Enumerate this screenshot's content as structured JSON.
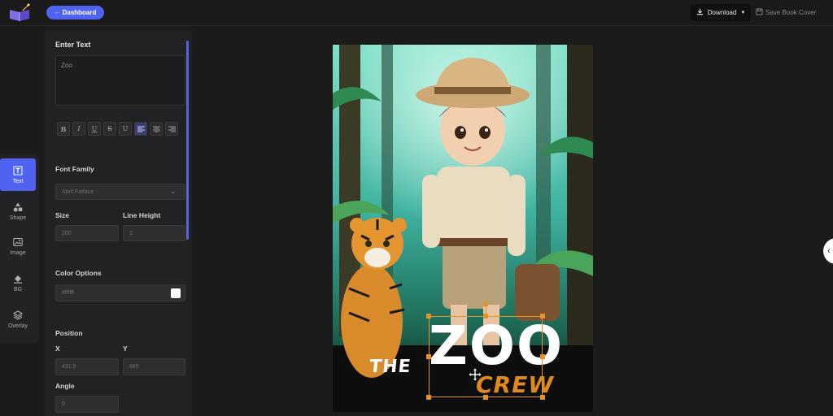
{
  "header": {
    "dashboard_label": "Dashboard",
    "download_label": "Download",
    "save_label": "Save Book Cover"
  },
  "tools": [
    {
      "label": "Text",
      "icon": "text-icon",
      "active": true
    },
    {
      "label": "Shape",
      "icon": "shapes-icon",
      "active": false
    },
    {
      "label": "Image",
      "icon": "image-icon",
      "active": false
    },
    {
      "label": "BG",
      "icon": "paint-bucket-icon",
      "active": false
    },
    {
      "label": "Overlay",
      "icon": "layers-icon",
      "active": false
    }
  ],
  "panel": {
    "enter_text_label": "Enter Text",
    "text_value": "Zoo",
    "format_buttons": [
      "B",
      "I",
      "U",
      "S",
      "U",
      "align-left",
      "align-center",
      "align-right"
    ],
    "font_family_label": "Font Family",
    "font_family_value": "Abril Fatface",
    "size_label": "Size",
    "size_value": "200",
    "line_height_label": "Line Height",
    "line_height_value": "1",
    "color_options_label": "Color Options",
    "color_value": "#ffffff",
    "position_label": "Position",
    "x_label": "X",
    "x_value": "431.5",
    "y_label": "Y",
    "y_value": "885",
    "angle_label": "Angle",
    "angle_value": "0"
  },
  "cover": {
    "title_the": "THE",
    "title_zoo": "ZOO",
    "title_crew": "CREW",
    "accent_color": "#e08a1e",
    "selection_color": "#e0942a"
  },
  "colors": {
    "accent": "#4f63f0",
    "panel_bg": "#222224",
    "page_bg": "#1b1b1c"
  }
}
